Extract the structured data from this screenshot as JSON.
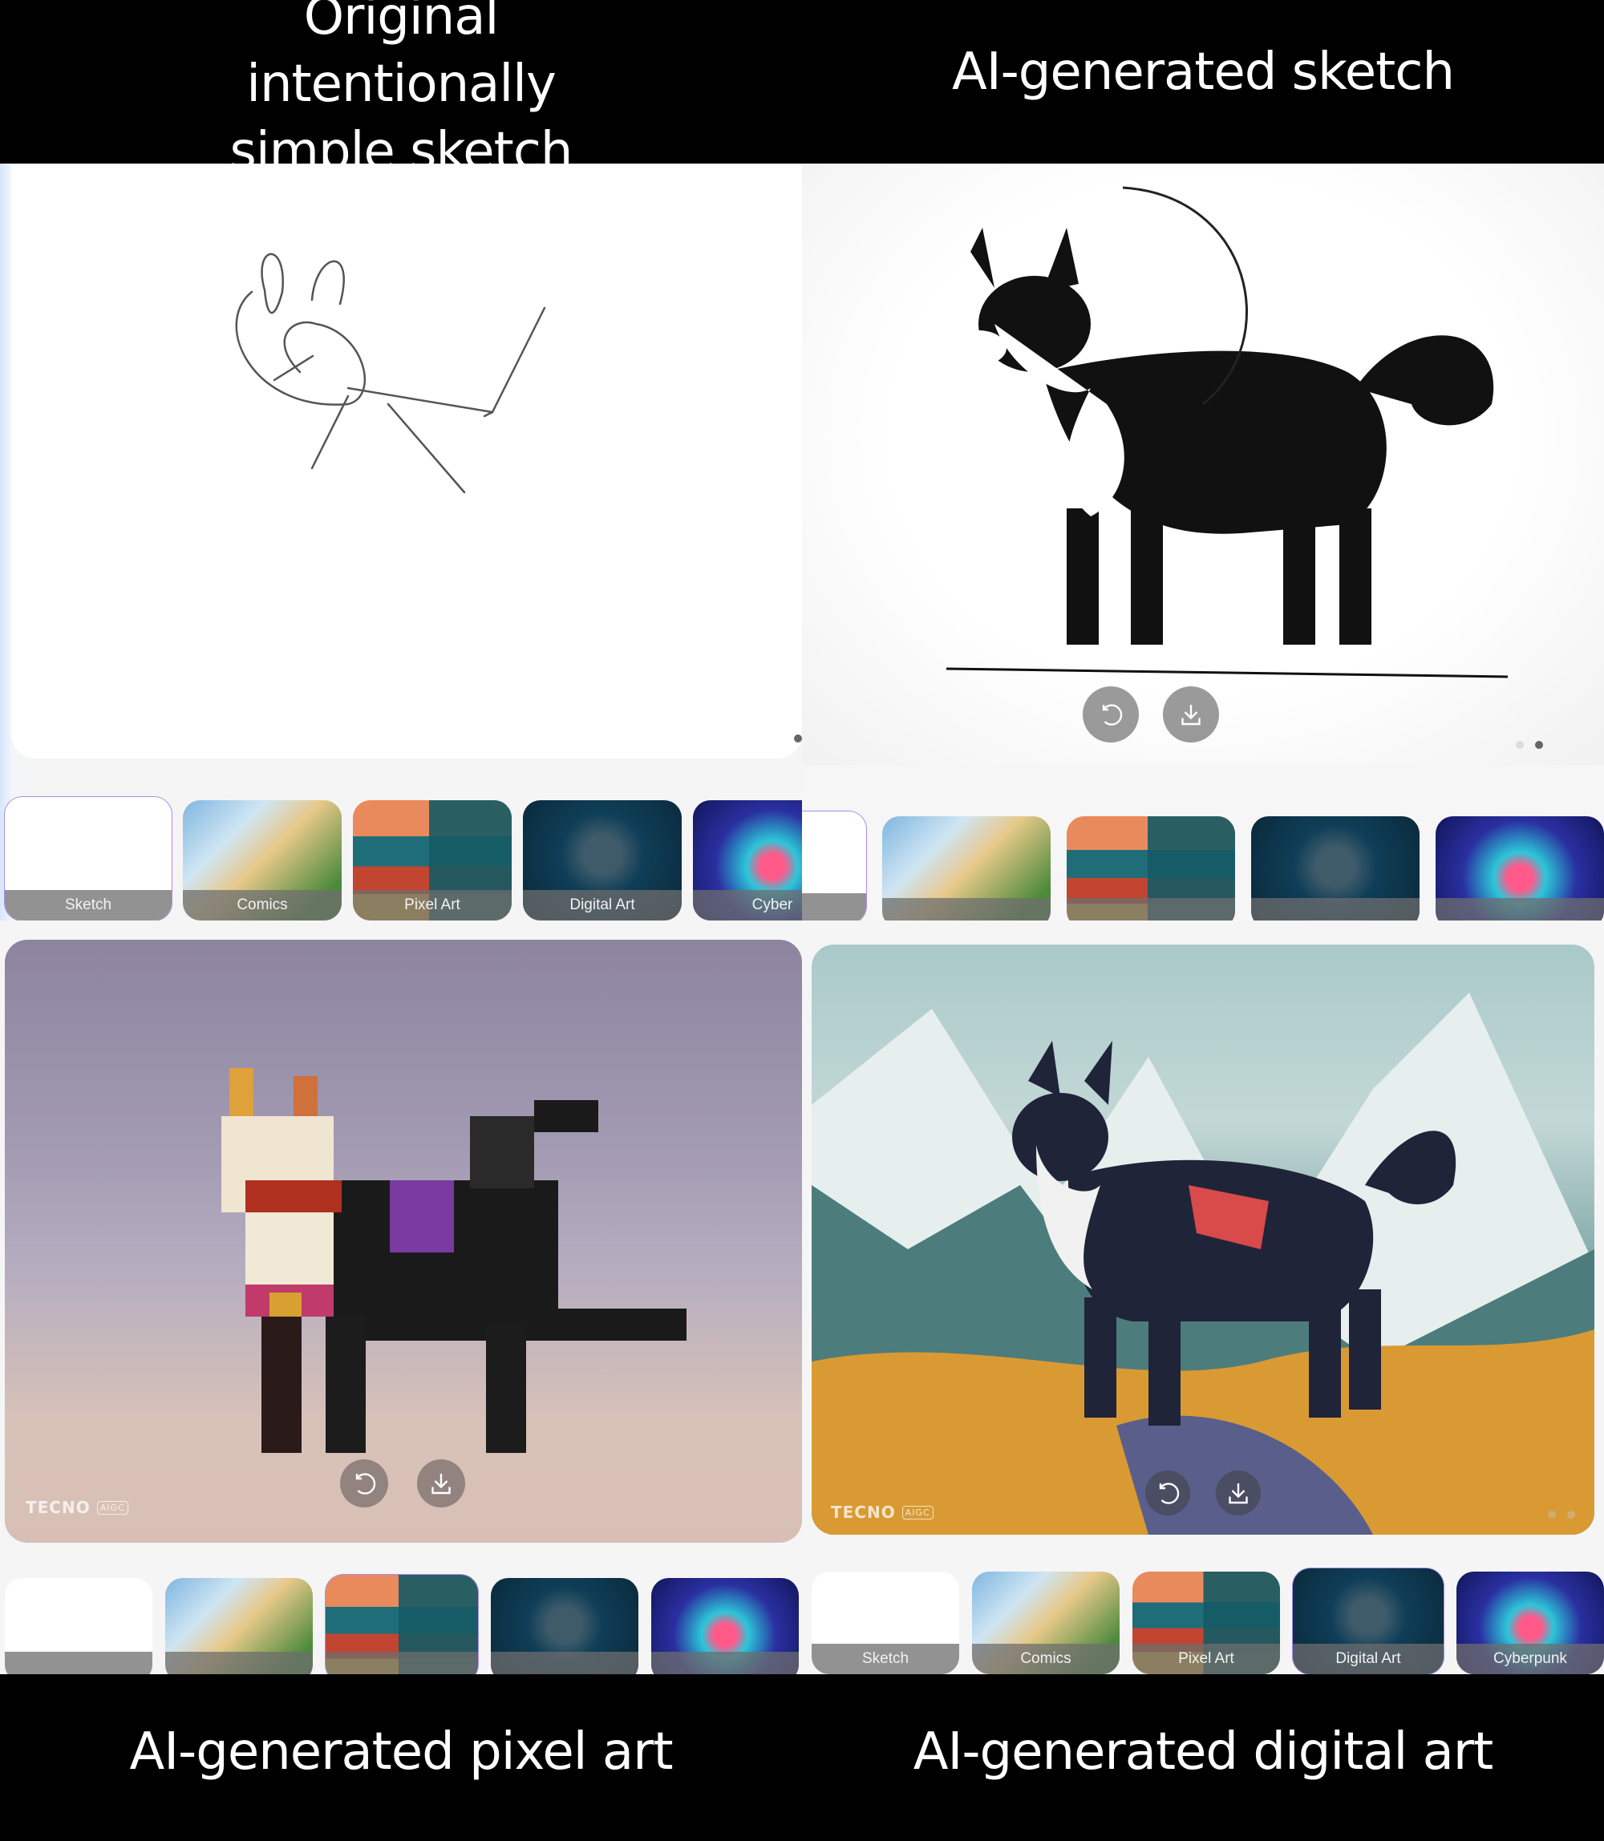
{
  "captions": {
    "top_left": "Original intentionally simple sketch",
    "top_right": "AI-generated sketch",
    "bottom_left": "AI-generated pixel art",
    "bottom_right": "AI-generated digital art"
  },
  "actions": {
    "regenerate_icon": "regenerate-icon",
    "download_icon": "download-icon"
  },
  "watermark": {
    "brand": "TECNO",
    "badge": "AIGC"
  },
  "pagination": {
    "total_pages": 2,
    "top_right_active_page": 2
  },
  "style_options": [
    "Sketch",
    "Comics",
    "Pixel Art",
    "Digital Art",
    "Cyberpunk"
  ],
  "panels": {
    "top_left": {
      "selected_style": "Sketch",
      "visible_labels": [
        "Sketch",
        "Comics",
        "Pixel Art",
        "Digital Art",
        "Cyber"
      ]
    },
    "top_right": {
      "selected_style": "Sketch"
    },
    "bottom_left": {
      "selected_style": "Pixel Art"
    },
    "bottom_right": {
      "selected_style": "Digital Art",
      "visible_labels": [
        "Sketch",
        "Comics",
        "Pixel Art",
        "Digital Art",
        "Cyberpunk"
      ]
    }
  },
  "colors": {
    "selected_outline": "#7b8cf0",
    "label_overlay": "#6e6e6e",
    "fab_background": "#787878"
  }
}
